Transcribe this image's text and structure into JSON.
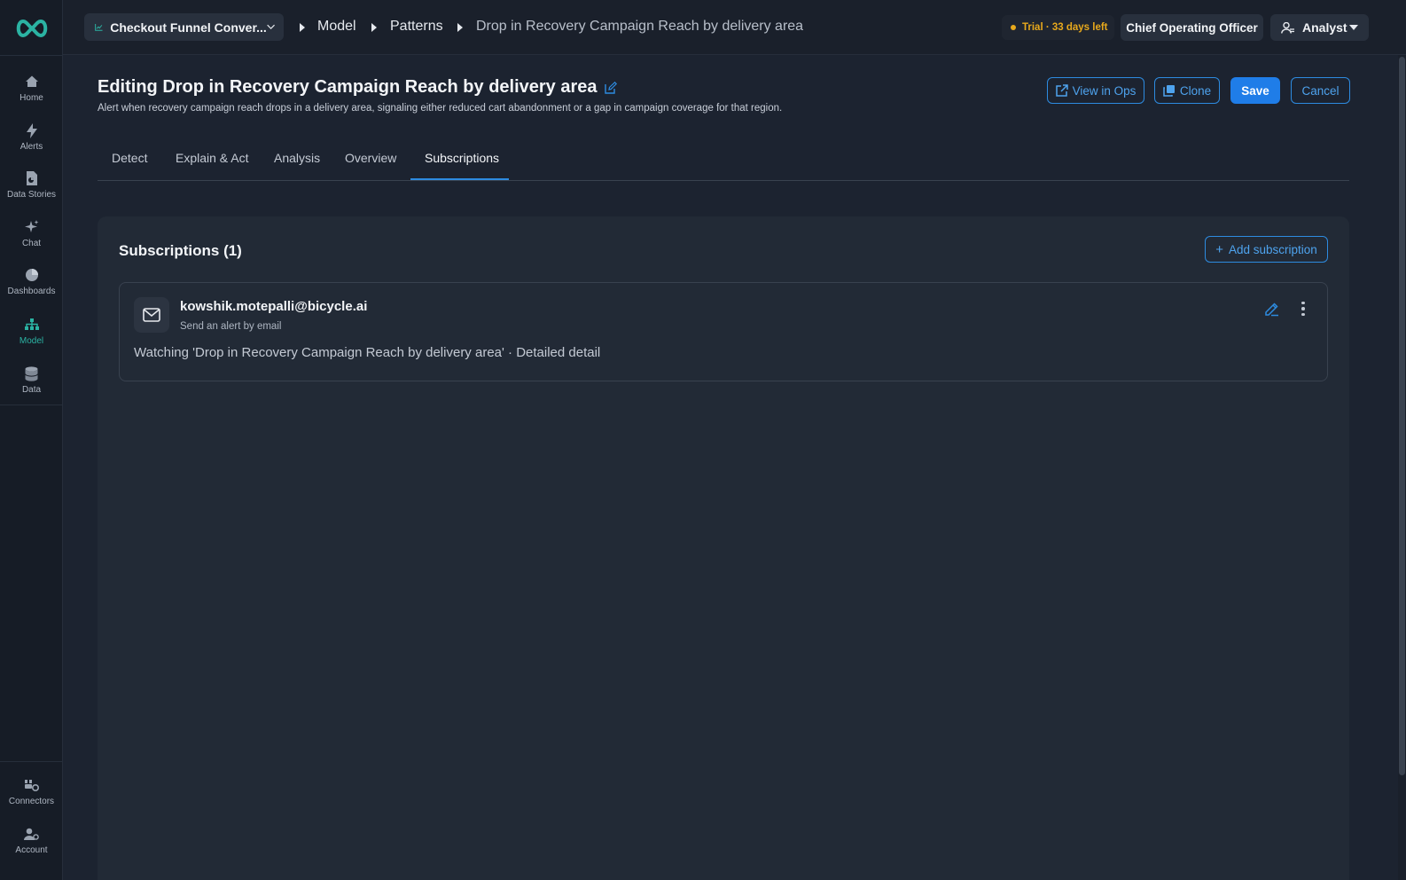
{
  "sidebar": {
    "items": [
      {
        "label": "Home",
        "icon": "home-icon"
      },
      {
        "label": "Alerts",
        "icon": "bolt-icon"
      },
      {
        "label": "Data Stories",
        "icon": "data-stories-icon"
      },
      {
        "label": "Chat",
        "icon": "sparkle-icon"
      },
      {
        "label": "Dashboards",
        "icon": "pie-chart-icon"
      },
      {
        "label": "Model",
        "icon": "hierarchy-icon",
        "active": true
      },
      {
        "label": "Data",
        "icon": "database-icon"
      }
    ],
    "bottom_items": [
      {
        "label": "Connectors",
        "icon": "connectors-icon"
      },
      {
        "label": "Account",
        "icon": "account-icon"
      }
    ]
  },
  "topbar": {
    "project_label": "Checkout Funnel Conver...",
    "breadcrumbs": [
      "Model",
      "Patterns",
      "Drop in Recovery Campaign Reach by delivery area"
    ],
    "trial_text": "Trial · 33 days left",
    "role_label": "Chief Operating Officer",
    "user_label": "Analyst"
  },
  "header": {
    "title": "Editing Drop in Recovery Campaign Reach by delivery area",
    "description": "Alert when recovery campaign reach drops in a delivery area, signaling either reduced cart abandonment or a gap in campaign coverage for that region.",
    "buttons": {
      "view_in_ops": "View in Ops",
      "clone": "Clone",
      "save": "Save",
      "cancel": "Cancel"
    }
  },
  "tabs": {
    "items": [
      "Detect",
      "Explain & Act",
      "Analysis",
      "Overview",
      "Subscriptions"
    ],
    "active": "Subscriptions"
  },
  "subscriptions": {
    "title": "Subscriptions (1)",
    "add_label": "Add subscription",
    "items": [
      {
        "email": "kowshik.motepalli@bicycle.ai",
        "method": "Send an alert by email",
        "watching": "Watching 'Drop in Recovery Campaign Reach by delivery area' · Detailed detail"
      }
    ]
  },
  "colors": {
    "accent": "#2d8be0",
    "active_nav": "#2bb3a3",
    "trial": "#e8a91c",
    "background": "#1c2330"
  }
}
